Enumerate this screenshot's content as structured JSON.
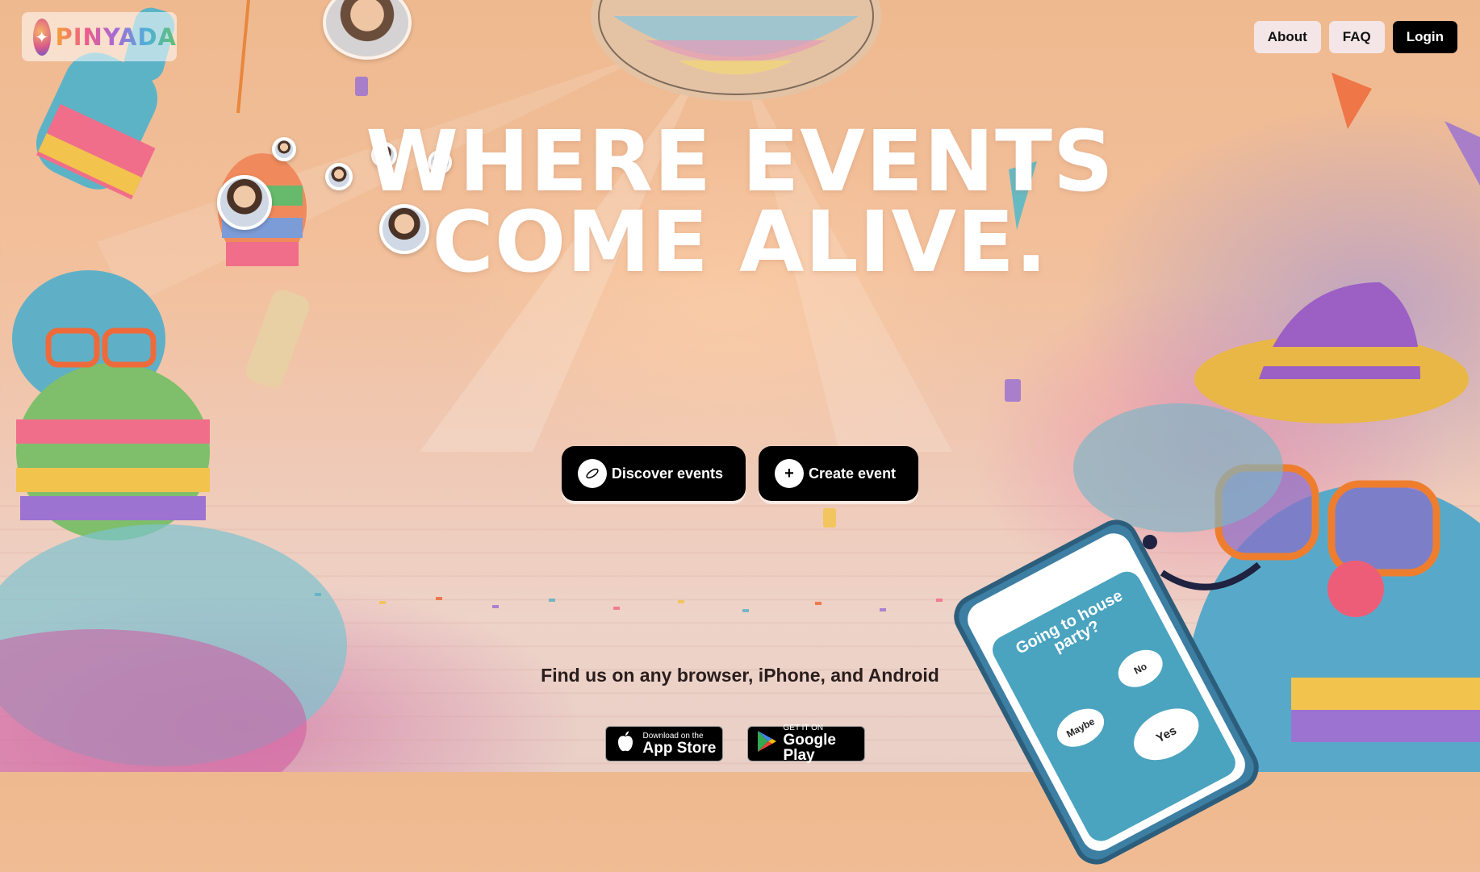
{
  "brand": {
    "name": "PINYADA",
    "logo_icon": "pinata-logo-icon"
  },
  "nav": {
    "about": "About",
    "faq": "FAQ",
    "login": "Login"
  },
  "hero": {
    "line1": "WHERE EVENTS",
    "line2": "COME ALIVE."
  },
  "cta": {
    "discover": {
      "label": "Discover events",
      "icon": "compass-icon"
    },
    "create": {
      "label": "Create event",
      "icon": "plus-icon"
    }
  },
  "platforms": {
    "text": "Find us on any browser, iPhone, and Android"
  },
  "stores": {
    "apple": {
      "small": "Download on the",
      "big": "App Store",
      "icon": "apple-icon"
    },
    "google": {
      "small": "GET IT ON",
      "big": "Google Play",
      "icon": "google-play-icon"
    }
  },
  "phone": {
    "question": "Going to house party?",
    "no": "No",
    "maybe": "Maybe",
    "yes": "Yes"
  },
  "colors": {
    "accent_dark": "#000000",
    "nav_light": "#f4e6e6",
    "headline": "#ffffff"
  }
}
